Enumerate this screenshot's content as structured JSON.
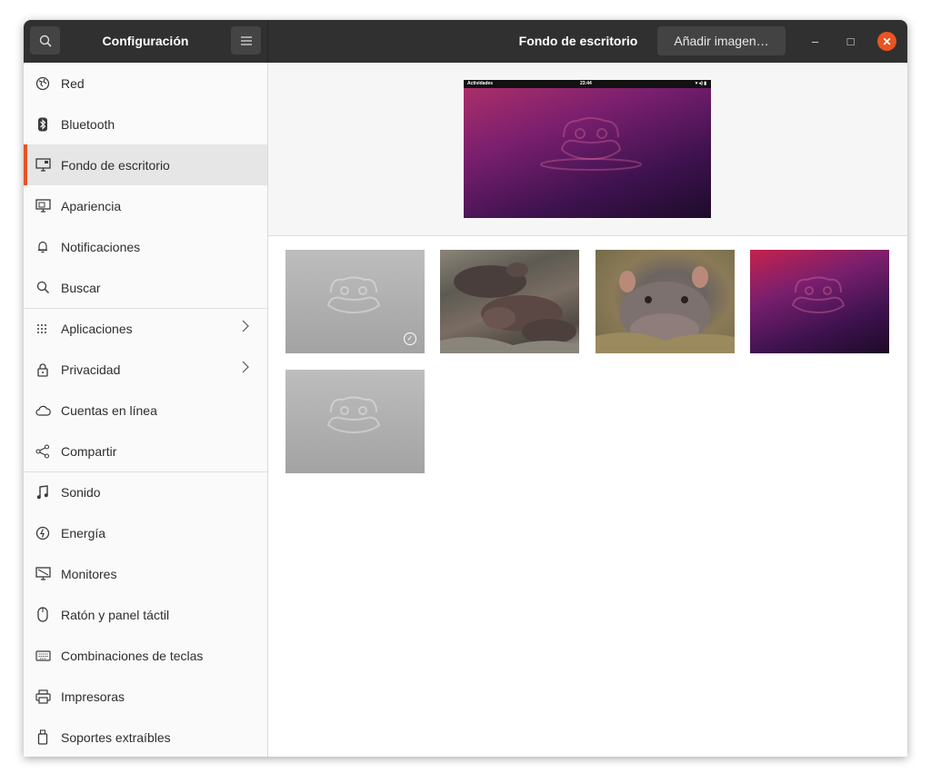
{
  "header": {
    "left_title": "Configuración",
    "main_title": "Fondo de escritorio",
    "add_button": "Añadir imagen…",
    "minimize": "‒",
    "maximize": "□",
    "close": "✕"
  },
  "sidebar": {
    "items": [
      {
        "label": "Red",
        "icon": "network-icon"
      },
      {
        "label": "Bluetooth",
        "icon": "bluetooth-icon"
      },
      {
        "label": "Fondo de escritorio",
        "icon": "background-icon",
        "selected": true
      },
      {
        "label": "Apariencia",
        "icon": "appearance-icon"
      },
      {
        "label": "Notificaciones",
        "icon": "bell-icon"
      },
      {
        "label": "Buscar",
        "icon": "search-icon"
      },
      {
        "label": "Aplicaciones",
        "icon": "apps-grid-icon",
        "chevron": true
      },
      {
        "label": "Privacidad",
        "icon": "lock-icon",
        "chevron": true
      },
      {
        "label": "Cuentas en línea",
        "icon": "cloud-icon"
      },
      {
        "label": "Compartir",
        "icon": "share-icon"
      },
      {
        "label": "Sonido",
        "icon": "music-note-icon"
      },
      {
        "label": "Energía",
        "icon": "power-icon"
      },
      {
        "label": "Monitores",
        "icon": "monitor-icon"
      },
      {
        "label": "Ratón y panel táctil",
        "icon": "mouse-icon"
      },
      {
        "label": "Combinaciones de teclas",
        "icon": "keyboard-icon"
      },
      {
        "label": "Impresoras",
        "icon": "printer-icon"
      },
      {
        "label": "Soportes extraíbles",
        "icon": "removable-media-icon"
      }
    ]
  },
  "preview": {
    "topbar_activities": "Actividades",
    "topbar_clock": "23:44",
    "topbar_tray": "▾ ◂) ▮"
  },
  "wallpapers": [
    {
      "style": "gray",
      "selected": true
    },
    {
      "style": "photo1",
      "selected": false
    },
    {
      "style": "photo2",
      "selected": false
    },
    {
      "style": "purple",
      "selected": false
    },
    {
      "style": "gray",
      "selected": false
    }
  ],
  "colors": {
    "accent": "#e95420",
    "headerbar": "#303030",
    "sidebar_selected": "#e6e6e6"
  }
}
